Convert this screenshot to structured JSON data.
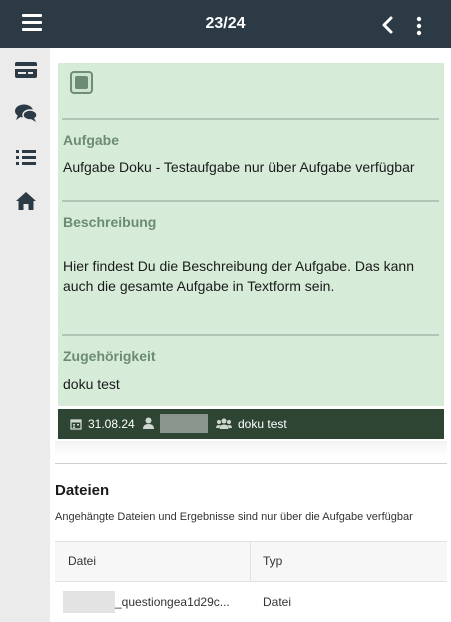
{
  "header": {
    "counter": "23/24",
    "menu_icon": "hamburger-menu-icon",
    "back_icon": "chevron-left-icon",
    "more_icon": "vertical-dots-icon"
  },
  "sidebar": {
    "items": [
      {
        "icon": "card-icon"
      },
      {
        "icon": "chat-icon"
      },
      {
        "icon": "list-icon"
      },
      {
        "icon": "home-icon"
      }
    ]
  },
  "task_card": {
    "task_label": "Aufgabe",
    "task_value": "Aufgabe Doku - Testaufgabe nur über Aufgabe verfügbar",
    "description_label": "Beschreibung",
    "description_value": "Hier findest Du die Beschreibung der Aufgabe. Das kann auch die gesamte Aufgabe in Textform sein.",
    "membership_label": "Zugehörigkeit",
    "membership_value": "doku test",
    "colors": {
      "background": "#d6ecd9",
      "label": "#6b8b73",
      "footer": "#2e4534"
    }
  },
  "card_footer": {
    "date": "31.08.24",
    "group": "doku test"
  },
  "files": {
    "title": "Dateien",
    "subtitle": "Angehängte Dateien und Ergebnisse sind nur über die Aufgabe verfügbar",
    "columns": [
      "Datei",
      "Typ"
    ],
    "rows": [
      {
        "file": "_questiongea1d29c...",
        "type": "Datei"
      }
    ]
  }
}
